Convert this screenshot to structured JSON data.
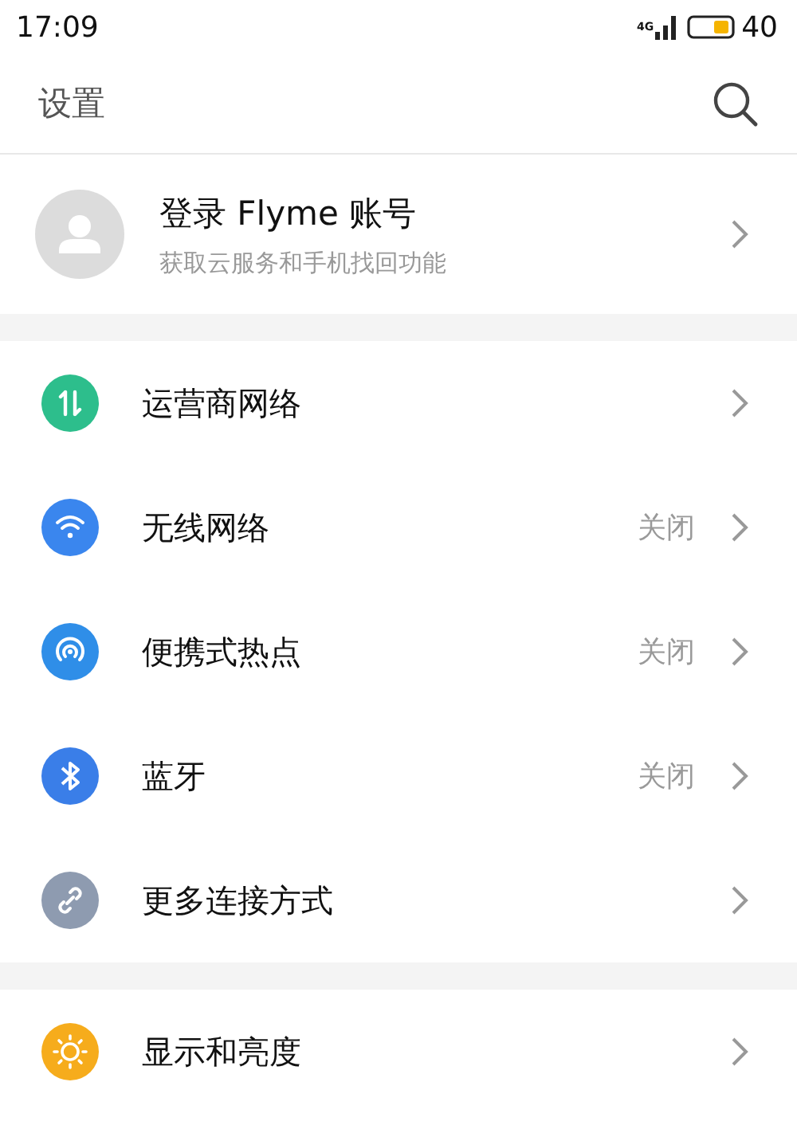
{
  "status_bar": {
    "time": "17:09",
    "network": "4G",
    "battery": "40"
  },
  "header": {
    "title": "设置"
  },
  "account": {
    "title": "登录 Flyme 账号",
    "subtitle": "获取云服务和手机找回功能"
  },
  "sections": [
    {
      "items": [
        {
          "kind": "carrier",
          "label": "运营商网络",
          "color": "#2dbe8c"
        },
        {
          "kind": "wifi",
          "label": "无线网络",
          "value": "关闭",
          "color": "#3a86ee"
        },
        {
          "kind": "hotspot",
          "label": "便携式热点",
          "value": "关闭",
          "color": "#2f8ee8"
        },
        {
          "kind": "bluetooth",
          "label": "蓝牙",
          "value": "关闭",
          "color": "#3a7ee8"
        },
        {
          "kind": "link",
          "label": "更多连接方式",
          "color": "#8e9bb0"
        }
      ]
    },
    {
      "items": [
        {
          "kind": "brightness",
          "label": "显示和亮度",
          "color": "#f6ac1c"
        }
      ]
    }
  ]
}
